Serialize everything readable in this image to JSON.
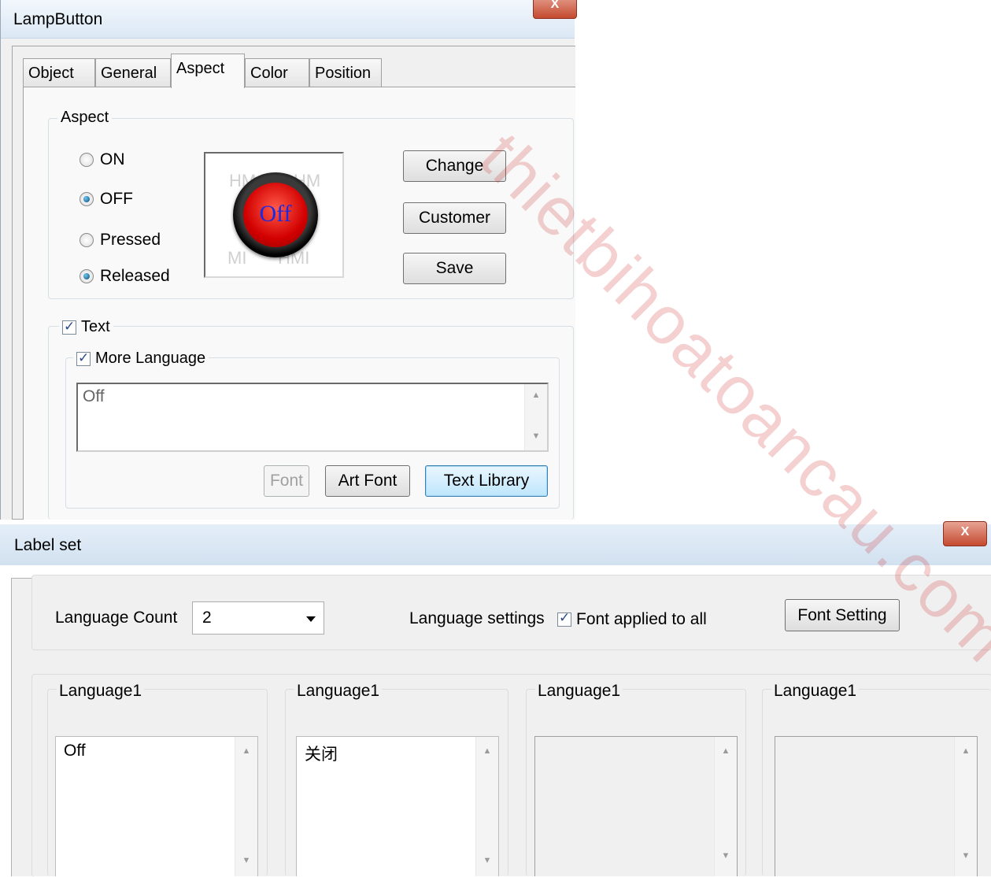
{
  "lamp_dialog": {
    "title": "LampButton",
    "tabs": [
      "Object",
      "General",
      "Aspect",
      "Color",
      "Position"
    ],
    "active_tab": "Aspect",
    "aspect_group_label": "Aspect",
    "radios": [
      {
        "label": "ON",
        "checked": false
      },
      {
        "label": "OFF",
        "checked": true
      },
      {
        "label": "Pressed",
        "checked": false
      },
      {
        "label": "Released",
        "checked": true
      }
    ],
    "preview": {
      "lamp_text": "Off",
      "bg_text_1": "HM",
      "bg_text_2": "HM",
      "bg_text_3": "MI",
      "bg_text_4": "HMI"
    },
    "buttons": {
      "change": "Change",
      "customer": "Customer",
      "save": "Save"
    },
    "text_checkbox": {
      "label": "Text",
      "checked": true
    },
    "more_language_checkbox": {
      "label": "More Language",
      "checked": true
    },
    "text_value": "Off",
    "font_button": "Font",
    "art_font_button": "Art Font",
    "text_library_button": "Text Library"
  },
  "label_dialog": {
    "title": "Label set",
    "language_count_label": "Language Count",
    "language_count_value": "2",
    "language_settings_label": "Language settings",
    "font_applied_label": "Font applied to all",
    "font_applied_checked": true,
    "font_setting_button": "Font Setting",
    "languages": [
      {
        "label": "Language1",
        "text": "Off"
      },
      {
        "label": "Language1",
        "text": "关闭"
      },
      {
        "label": "Language1",
        "text": ""
      },
      {
        "label": "Language1",
        "text": ""
      }
    ]
  },
  "watermark": "thietbihoatoancau.com",
  "colors": {
    "lamp_red": "#d20000",
    "lamp_text_blue": "#1a2be0",
    "watermark_red": "#c91c1c"
  },
  "icons": [
    "close-icon",
    "radio-icon",
    "checkbox-icon",
    "scroll-up-icon",
    "scroll-down-icon",
    "dropdown-caret-icon"
  ]
}
